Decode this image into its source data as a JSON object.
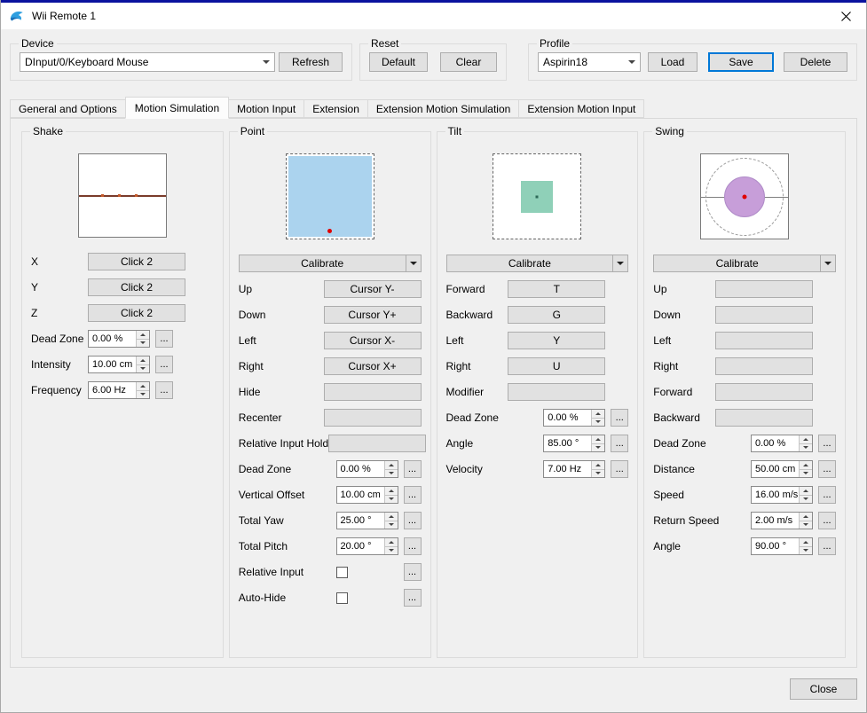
{
  "window": {
    "title": "Wii Remote 1"
  },
  "ui": {
    "dots": "..."
  },
  "device": {
    "title": "Device",
    "selected": "DInput/0/Keyboard Mouse",
    "refresh": "Refresh"
  },
  "reset": {
    "title": "Reset",
    "default": "Default",
    "clear": "Clear"
  },
  "profile": {
    "title": "Profile",
    "selected": "Aspirin18",
    "load": "Load",
    "save": "Save",
    "delete": "Delete"
  },
  "tabs": [
    {
      "label": "General and Options"
    },
    {
      "label": "Motion Simulation"
    },
    {
      "label": "Motion Input"
    },
    {
      "label": "Extension"
    },
    {
      "label": "Extension Motion Simulation"
    },
    {
      "label": "Extension Motion Input"
    }
  ],
  "shake": {
    "title": "Shake",
    "mappings": [
      {
        "label": "X",
        "value": "Click 2"
      },
      {
        "label": "Y",
        "value": "Click 2"
      },
      {
        "label": "Z",
        "value": "Click 2"
      }
    ],
    "settings": [
      {
        "label": "Dead Zone",
        "value": "0.00 %"
      },
      {
        "label": "Intensity",
        "value": "10.00 cm"
      },
      {
        "label": "Frequency",
        "value": "6.00 Hz"
      }
    ]
  },
  "point": {
    "title": "Point",
    "calibrate": "Calibrate",
    "mappings": [
      {
        "label": "Up",
        "value": "Cursor Y-"
      },
      {
        "label": "Down",
        "value": "Cursor Y+"
      },
      {
        "label": "Left",
        "value": "Cursor X-"
      },
      {
        "label": "Right",
        "value": "Cursor X+"
      },
      {
        "label": "Hide",
        "value": ""
      },
      {
        "label": "Recenter",
        "value": ""
      },
      {
        "label": "Relative Input Hold",
        "value": ""
      }
    ],
    "settings": [
      {
        "label": "Dead Zone",
        "value": "0.00 %"
      },
      {
        "label": "Vertical Offset",
        "value": "10.00 cm"
      },
      {
        "label": "Total Yaw",
        "value": "25.00 °"
      },
      {
        "label": "Total Pitch",
        "value": "20.00 °"
      }
    ],
    "checkboxes": [
      {
        "label": "Relative Input",
        "checked": false
      },
      {
        "label": "Auto-Hide",
        "checked": false
      }
    ]
  },
  "tilt": {
    "title": "Tilt",
    "calibrate": "Calibrate",
    "mappings": [
      {
        "label": "Forward",
        "value": "T"
      },
      {
        "label": "Backward",
        "value": "G"
      },
      {
        "label": "Left",
        "value": "Y"
      },
      {
        "label": "Right",
        "value": "U"
      },
      {
        "label": "Modifier",
        "value": ""
      }
    ],
    "settings": [
      {
        "label": "Dead Zone",
        "value": "0.00 %"
      },
      {
        "label": "Angle",
        "value": "85.00 °"
      },
      {
        "label": "Velocity",
        "value": "7.00 Hz"
      }
    ]
  },
  "swing": {
    "title": "Swing",
    "calibrate": "Calibrate",
    "mappings": [
      {
        "label": "Up",
        "value": ""
      },
      {
        "label": "Down",
        "value": ""
      },
      {
        "label": "Left",
        "value": ""
      },
      {
        "label": "Right",
        "value": ""
      },
      {
        "label": "Forward",
        "value": ""
      },
      {
        "label": "Backward",
        "value": ""
      }
    ],
    "settings": [
      {
        "label": "Dead Zone",
        "value": "0.00 %"
      },
      {
        "label": "Distance",
        "value": "50.00 cm"
      },
      {
        "label": "Speed",
        "value": "16.00 m/s"
      },
      {
        "label": "Return Speed",
        "value": "2.00 m/s"
      },
      {
        "label": "Angle",
        "value": "90.00 °"
      }
    ]
  },
  "footer": {
    "close": "Close"
  },
  "colors": {
    "accent": "#0078d7",
    "window_accent": "#0a139e",
    "point_fill": "#abd3ee",
    "tilt_fill": "#8fd0b8",
    "tilt_dot": "#2d6a58",
    "swing_fill": "#c79ed9",
    "cursor_dot": "#e00000",
    "shake_line": "#7a3b2b",
    "shake_dot": "#c55a2a"
  }
}
